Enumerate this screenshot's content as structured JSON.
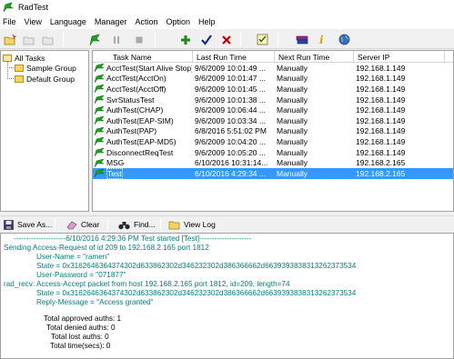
{
  "window": {
    "title": "RadTest"
  },
  "menu": [
    "File",
    "View",
    "Language",
    "Manager",
    "Action",
    "Option",
    "Help"
  ],
  "tree": {
    "root": "All Tasks",
    "children": [
      "Sample Group",
      "Default Group"
    ]
  },
  "list": {
    "columns": [
      "Task Name",
      "Last Run Time",
      "Next Run Time",
      "Server IP"
    ],
    "rows": [
      {
        "name": "AcctTest(Start Alive Stop)",
        "last": "9/6/2009 10:01:49 ...",
        "next": "Manually",
        "ip": "192.168.1.149"
      },
      {
        "name": "AcctTest(AcctOn)",
        "last": "9/6/2009 10:01:47 ...",
        "next": "Manually",
        "ip": "192.168.1.149"
      },
      {
        "name": "AcctTest(AcctOff)",
        "last": "9/6/2009 10:01:45 ...",
        "next": "Manually",
        "ip": "192.168.1.149"
      },
      {
        "name": "SvrStatusTest",
        "last": "9/6/2009 10:01:38 ...",
        "next": "Manually",
        "ip": "192.168.1.149"
      },
      {
        "name": "AuthTest(CHAP)",
        "last": "9/6/2009 10:06:44 ...",
        "next": "Manually",
        "ip": "192.168.1.149"
      },
      {
        "name": "AuthTest(EAP-SIM)",
        "last": "9/6/2009 10:03:34 ...",
        "next": "Manually",
        "ip": "192.168.1.149"
      },
      {
        "name": "AuthTest(PAP)",
        "last": "6/8/2016 5:51:02 PM",
        "next": "Manually",
        "ip": "192.168.1.149"
      },
      {
        "name": "AuthTest(EAP-MD5)",
        "last": "9/6/2009 10:04:20 ...",
        "next": "Manually",
        "ip": "192.168.1.149"
      },
      {
        "name": "DisconnectReqTest",
        "last": "9/6/2009 10:05:20 ...",
        "next": "Manually",
        "ip": "192.168.1.149"
      },
      {
        "name": "MSG",
        "last": "6/10/2016 10:31:14...",
        "next": "Manually",
        "ip": "192.168.2.165"
      },
      {
        "name": "Test",
        "last": "6/10/2016 4:29:34 ...",
        "next": "Manually",
        "ip": "192.168.2.165",
        "selected": true
      }
    ]
  },
  "logbar": {
    "save": "Save As...",
    "clear": "Clear",
    "find": "Find...",
    "view_log": "View Log"
  },
  "log": [
    {
      "text": "---------------------6/10/2016 4:29:36 PM Test started  [Test]---------------------",
      "color": "teal",
      "indent": 14
    },
    {
      "text": "Sending Access-Request of id 209 to 192.168.2.165 port 1812",
      "color": "teal",
      "indent": 3
    },
    {
      "text": "User-Name = \"ramen\"",
      "color": "teal",
      "indent": 39
    },
    {
      "text": "State = 0x3162646364374302d633862302d346232302d386366662d6639393838313262373534",
      "color": "teal",
      "indent": 39
    },
    {
      "text": "User-Password = \"071877\"",
      "color": "teal",
      "indent": 39
    },
    {
      "text": "rad_recv: Access-Accept packet from host 192.168.2.165 port 1812, id=209, length=74",
      "color": "teal",
      "indent": 3
    },
    {
      "text": "State = 0x3162646364374302d633862302d346232302d386366662d6639393838313262373534",
      "color": "teal",
      "indent": 39
    },
    {
      "text": "Reply-Message = \"Access granted\"",
      "color": "teal",
      "indent": 39
    },
    {
      "text": "Total approved auths:  1",
      "color": "black",
      "indent": 47
    },
    {
      "text": "Total denied auths:  0",
      "color": "black",
      "indent": 50
    },
    {
      "text": "Total lost auths:  0",
      "color": "black",
      "indent": 55
    },
    {
      "text": "Total time(secs):  0",
      "color": "black",
      "indent": 54
    }
  ],
  "colors": {
    "selection": "#3399ff",
    "log_teal": "#008080",
    "flag_green": "#1aa31a"
  }
}
